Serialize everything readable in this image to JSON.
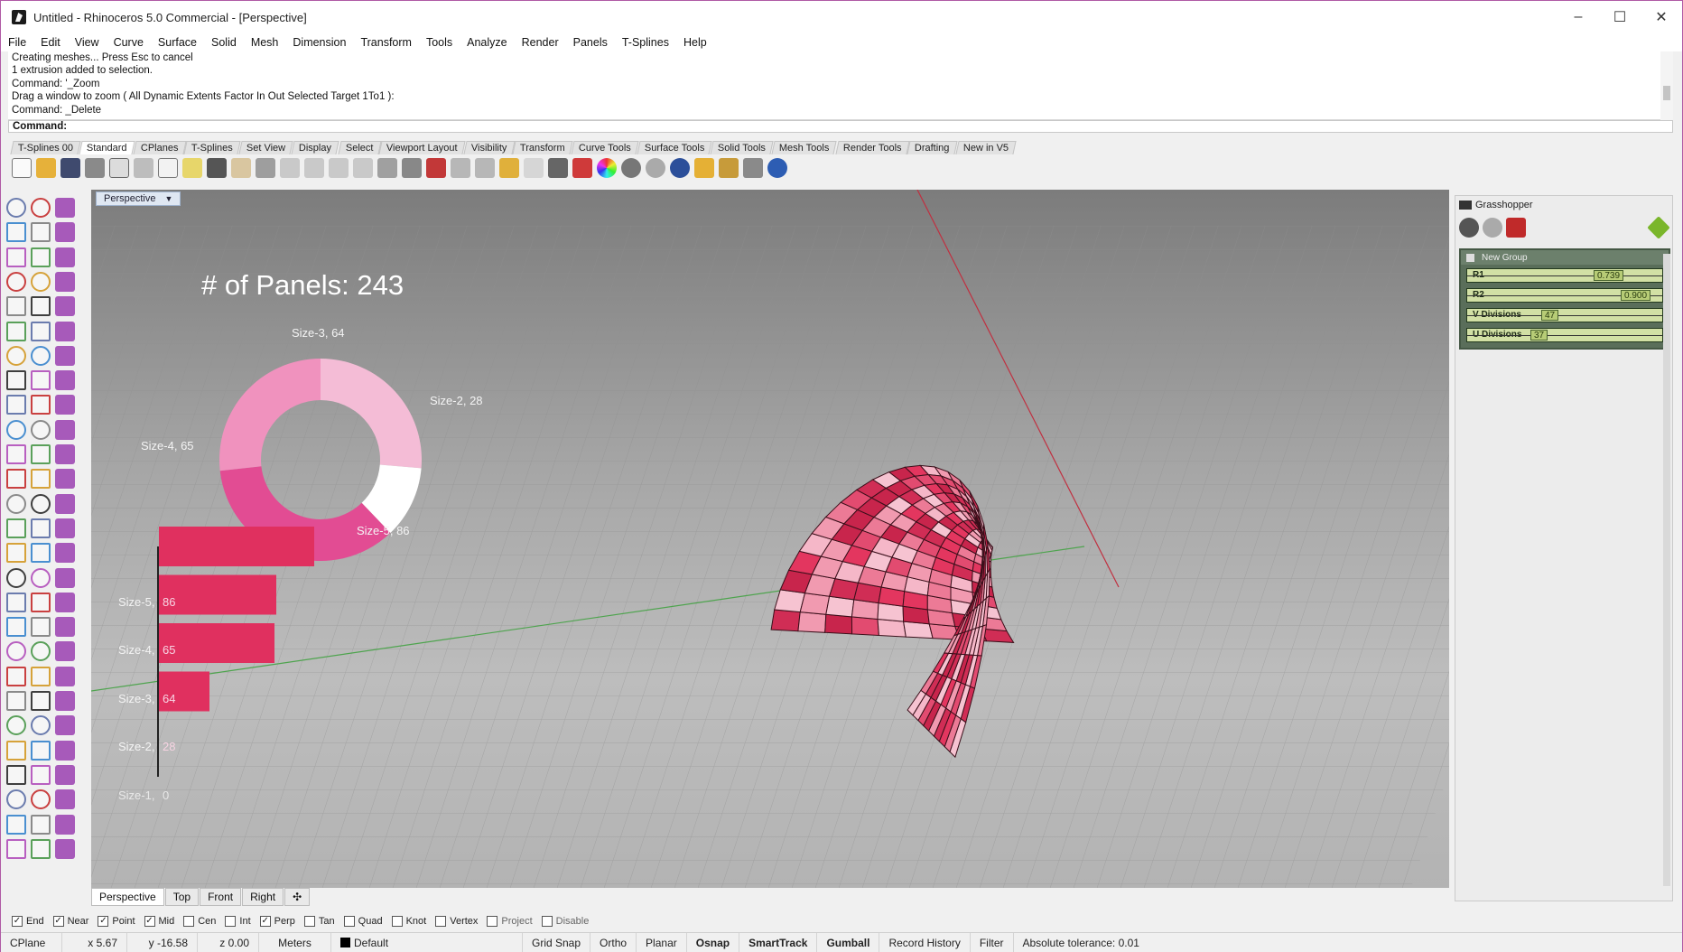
{
  "window": {
    "title": "Untitled - Rhinoceros 5.0 Commercial - [Perspective]",
    "minimize": "–",
    "maximize": "☐",
    "close": "✕"
  },
  "menu": [
    "File",
    "Edit",
    "View",
    "Curve",
    "Surface",
    "Solid",
    "Mesh",
    "Dimension",
    "Transform",
    "Tools",
    "Analyze",
    "Render",
    "Panels",
    "T-Splines",
    "Help"
  ],
  "history": [
    "Creating meshes... Press Esc to cancel",
    "1 extrusion added to selection.",
    "Command: '_Zoom",
    "Drag a window to zoom ( All  Dynamic  Extents  Factor  In  Out  Selected  Target  1To1 ):",
    "Command: _Delete"
  ],
  "command": {
    "label": "Command:",
    "value": ""
  },
  "toolbar_tabs": [
    "T-Splines 00",
    "Standard",
    "CPlanes",
    "T-Splines",
    "Set View",
    "Display",
    "Select",
    "Viewport Layout",
    "Visibility",
    "Transform",
    "Curve Tools",
    "Surface Tools",
    "Solid Tools",
    "Mesh Tools",
    "Render Tools",
    "Drafting",
    "New in V5"
  ],
  "active_toolbar_tab": "Standard",
  "viewport": {
    "name": "Perspective",
    "panels_heading": "# of Panels: 243",
    "donut_labels": {
      "size3": "Size-3, 64",
      "size2": "Size-2, 28",
      "size4": "Size-4, 65",
      "size5": "Size-5, 86"
    },
    "bar_labels": {
      "size5": "Size-5,",
      "size4": "Size-4,",
      "size3": "Size-3,",
      "size2": "Size-2,",
      "size1": "Size-1,"
    },
    "bar_values": {
      "size5": "86",
      "size4": "65",
      "size3": "64",
      "size2": "28",
      "size1": "0"
    }
  },
  "chart_data": [
    {
      "type": "pie",
      "title": "# of Panels: 243",
      "categories": [
        "Size-3",
        "Size-2",
        "Size-5",
        "Size-4"
      ],
      "values": [
        64,
        28,
        86,
        65
      ],
      "colors": [
        "#f4bcd6",
        "#ffffff",
        "#e24c93",
        "#f092be"
      ]
    },
    {
      "type": "bar",
      "categories": [
        "Size-5",
        "Size-4",
        "Size-3",
        "Size-2",
        "Size-1"
      ],
      "values": [
        86,
        65,
        64,
        28,
        0
      ],
      "color": "#e0305f"
    }
  ],
  "view_tabs": [
    "Perspective",
    "Top",
    "Front",
    "Right"
  ],
  "add_view_tab": "✣",
  "osnaps": [
    {
      "label": "End",
      "checked": true
    },
    {
      "label": "Near",
      "checked": true
    },
    {
      "label": "Point",
      "checked": true
    },
    {
      "label": "Mid",
      "checked": true
    },
    {
      "label": "Cen",
      "checked": false
    },
    {
      "label": "Int",
      "checked": false
    },
    {
      "label": "Perp",
      "checked": true
    },
    {
      "label": "Tan",
      "checked": false
    },
    {
      "label": "Quad",
      "checked": false
    },
    {
      "label": "Knot",
      "checked": false
    },
    {
      "label": "Vertex",
      "checked": false
    },
    {
      "label": "Project",
      "checked": false
    },
    {
      "label": "Disable",
      "checked": false
    }
  ],
  "status": {
    "cplane": "CPlane",
    "x": "x 5.67",
    "y": "y -16.58",
    "z": "z 0.00",
    "units": "Meters",
    "layer": "Default",
    "toggles": [
      {
        "label": "Grid Snap",
        "bold": false
      },
      {
        "label": "Ortho",
        "bold": false
      },
      {
        "label": "Planar",
        "bold": false
      },
      {
        "label": "Osnap",
        "bold": true
      },
      {
        "label": "SmartTrack",
        "bold": true
      },
      {
        "label": "Gumball",
        "bold": true
      },
      {
        "label": "Record History",
        "bold": false
      },
      {
        "label": "Filter",
        "bold": false
      }
    ],
    "tolerance": "Absolute tolerance: 0.01"
  },
  "grasshopper": {
    "title": "Grasshopper",
    "group_name": "New Group",
    "sliders": [
      {
        "name": "R1",
        "value": "0.739",
        "fraction": 0.739
      },
      {
        "name": "R2",
        "value": "0.900",
        "fraction": 0.9
      },
      {
        "name": "V Divisions",
        "value": "47",
        "fraction": 0.47
      },
      {
        "name": "U Divisions",
        "value": "37",
        "fraction": 0.37
      }
    ]
  },
  "colors": {
    "accent_pink": "#e0305f",
    "viewport_bg": "#a6a6a6",
    "slider_green": "#d2e0a5",
    "group_green": "#5a6e5a"
  }
}
